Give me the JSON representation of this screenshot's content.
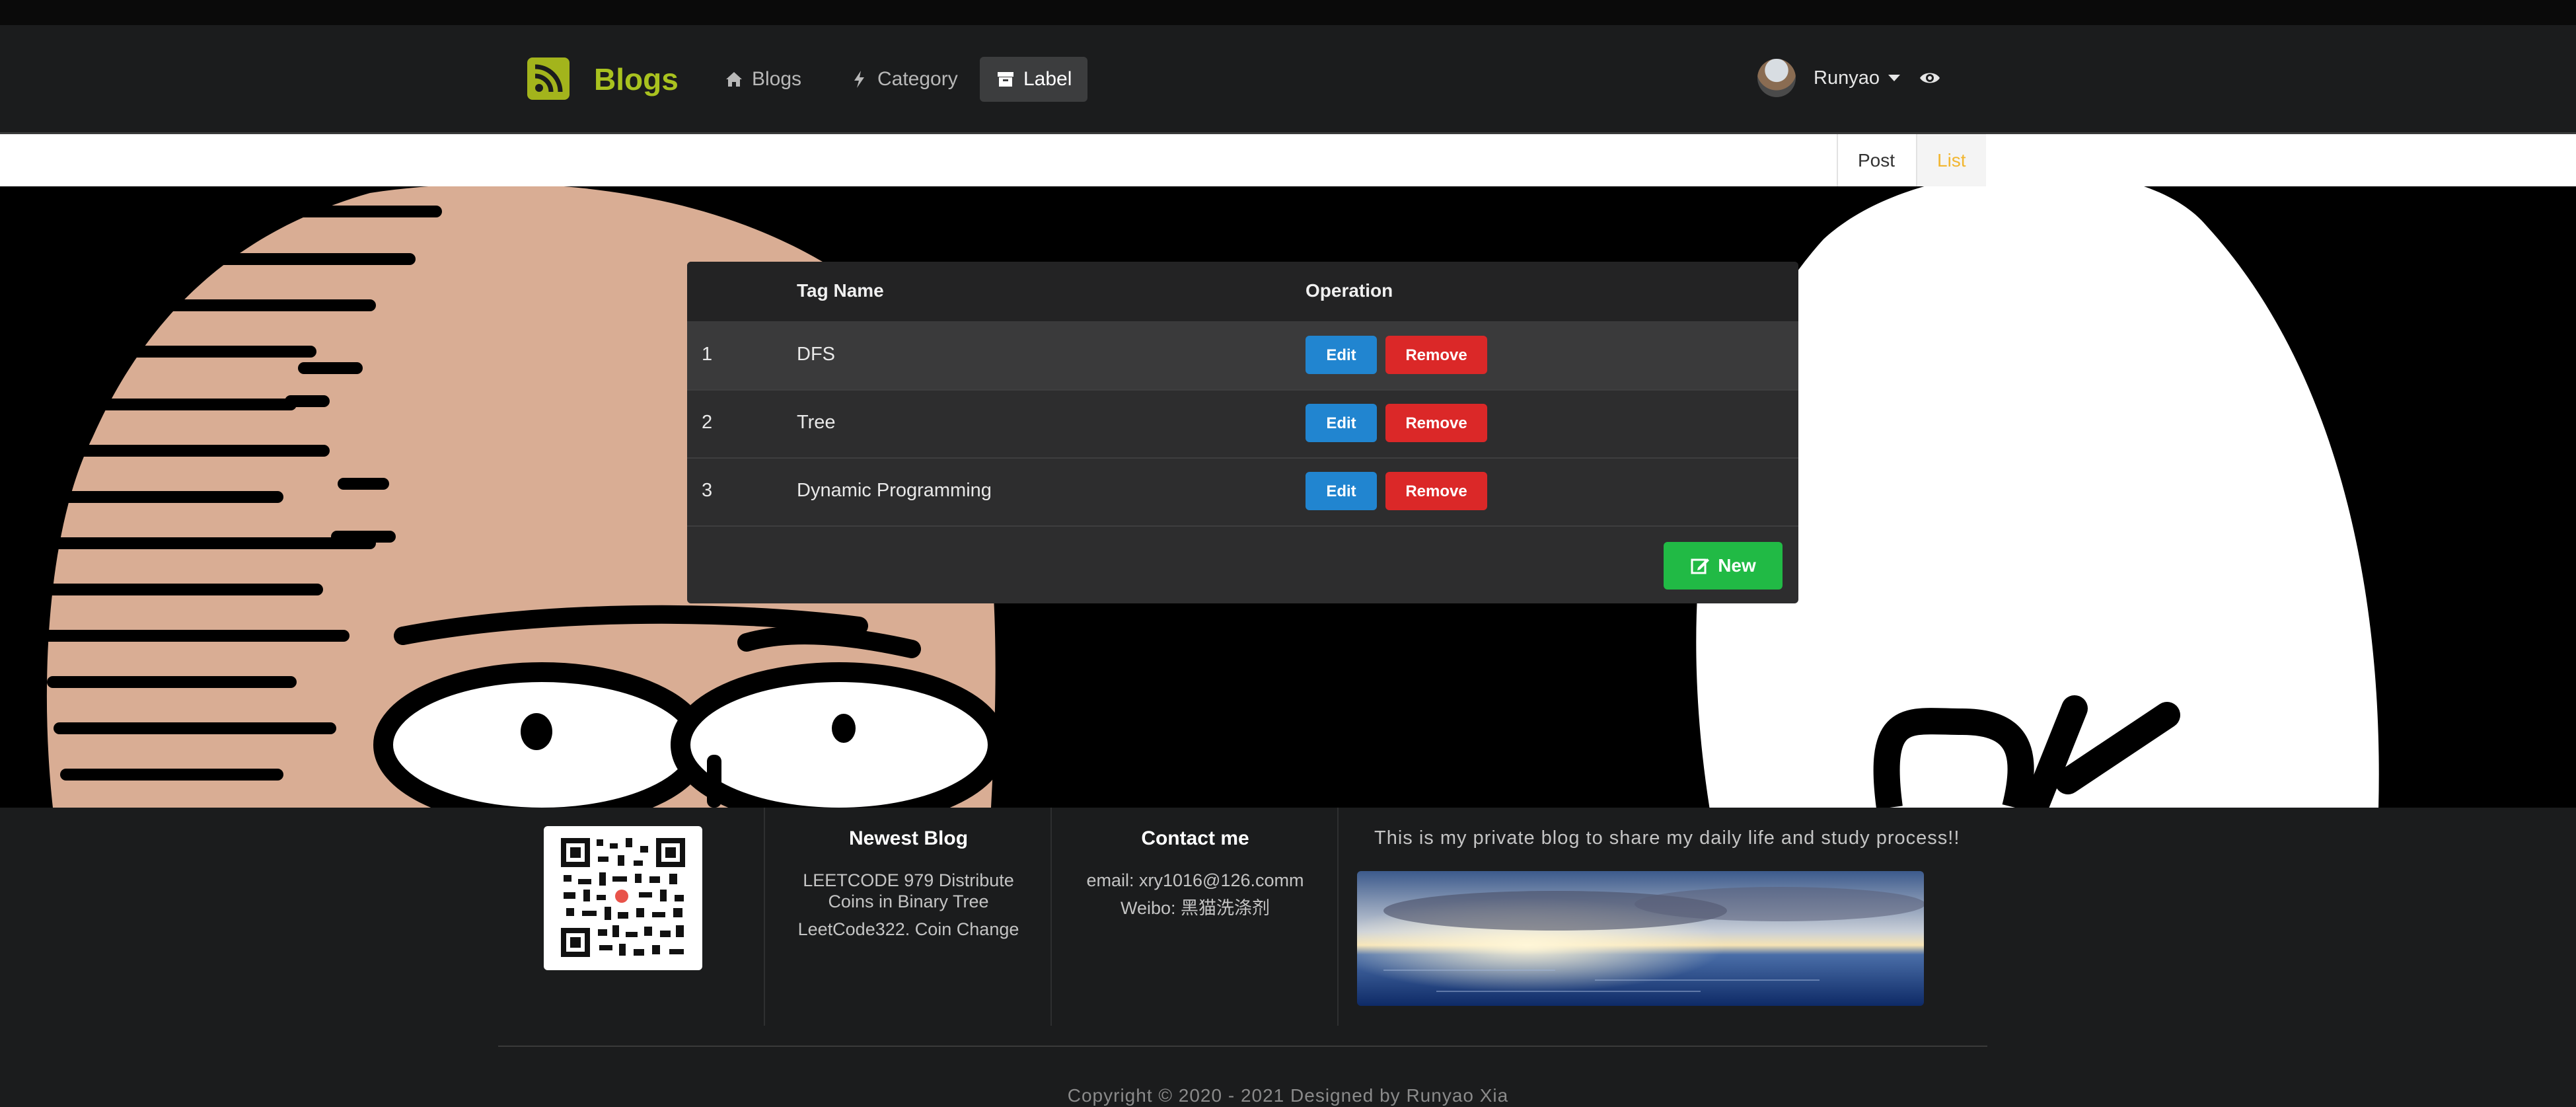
{
  "navbar": {
    "brand": "Blogs",
    "items": [
      {
        "label": "Blogs",
        "icon": "home-icon",
        "active": false
      },
      {
        "label": "Category",
        "icon": "bolt-icon",
        "active": false
      },
      {
        "label": "Label",
        "icon": "archive-icon",
        "active": true
      }
    ],
    "user": {
      "name": "Runyao"
    }
  },
  "subnav": {
    "tabs": [
      {
        "label": "Post",
        "active": false
      },
      {
        "label": "List",
        "active": true
      }
    ]
  },
  "table": {
    "headers": {
      "index": "",
      "name": "Tag Name",
      "operation": "Operation"
    },
    "rows": [
      {
        "index": "1",
        "name": "DFS"
      },
      {
        "index": "2",
        "name": "Tree"
      },
      {
        "index": "3",
        "name": "Dynamic Programming"
      }
    ],
    "edit_label": "Edit",
    "remove_label": "Remove",
    "new_label": "New"
  },
  "footer": {
    "newest_heading": "Newest Blog",
    "newest_items": [
      "LEETCODE 979 Distribute Coins in Binary Tree",
      "LeetCode322. Coin Change"
    ],
    "contact_heading": "Contact me",
    "contact_email": "email: xry1016@126.comm",
    "contact_weibo": "Weibo: 黑猫洗涤剂",
    "tagline": "This is my private blog to share my daily life and study process!!",
    "copyright": "Copyright © 2020 - 2021 Designed by Runyao Xia"
  },
  "colors": {
    "brand": "#a9c21f",
    "edit": "#2185d0",
    "remove": "#db2828",
    "new": "#21ba45",
    "active_tab": "#f2b630"
  }
}
